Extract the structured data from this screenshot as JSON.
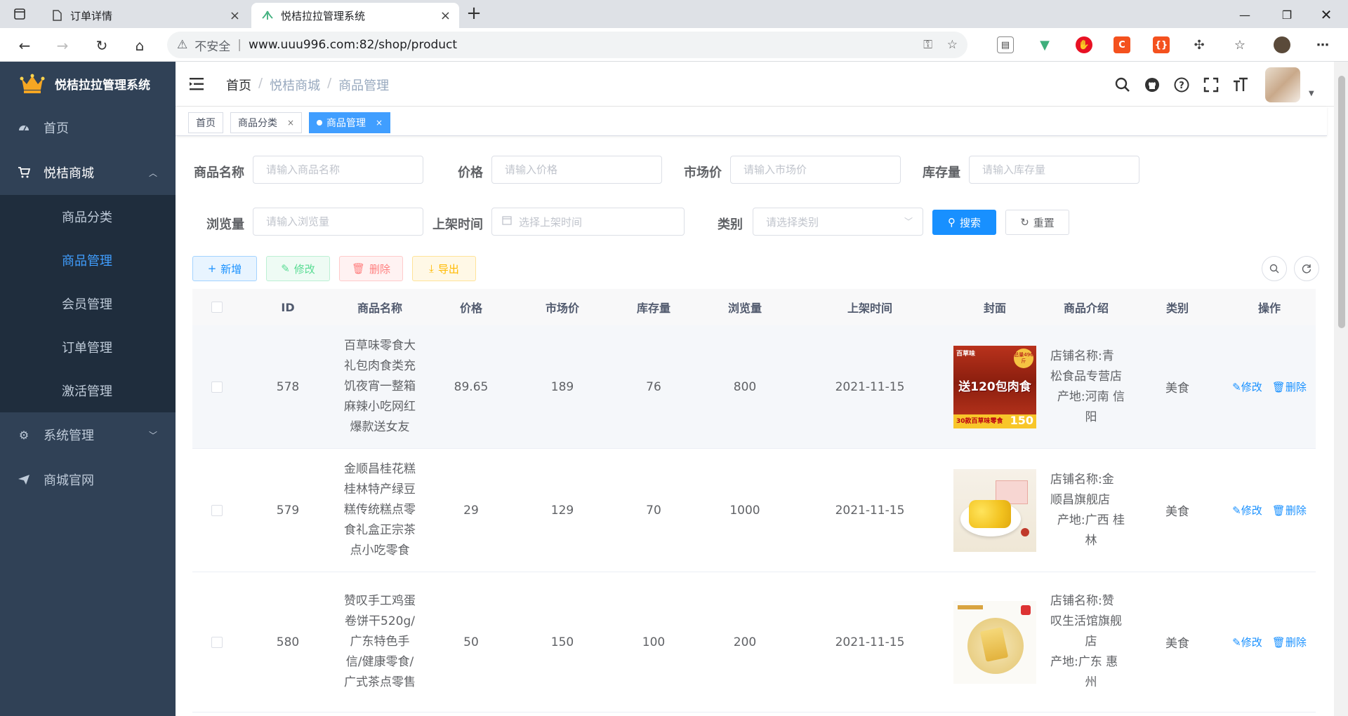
{
  "browser": {
    "tabs": [
      {
        "title": "订单详情",
        "active": false
      },
      {
        "title": "悦桔拉拉管理系统",
        "active": true
      }
    ],
    "address": {
      "security_label": "不安全",
      "url": "www.uuu996.com:82/shop/product"
    }
  },
  "sidebar": {
    "logo_title": "悦桔拉拉管理系统",
    "items": [
      {
        "label": "首页",
        "icon": "dashboard-icon"
      },
      {
        "label": "悦桔商城",
        "icon": "shopping-cart-icon",
        "expanded": true,
        "children": [
          {
            "label": "商品分类",
            "active": false
          },
          {
            "label": "商品管理",
            "active": true
          },
          {
            "label": "会员管理",
            "active": false
          },
          {
            "label": "订单管理",
            "active": false
          },
          {
            "label": "激活管理",
            "active": false
          }
        ]
      },
      {
        "label": "系统管理",
        "icon": "gear-icon"
      },
      {
        "label": "商城官网",
        "icon": "send-icon"
      }
    ]
  },
  "breadcrumb": [
    "首页",
    "悦桔商城",
    "商品管理"
  ],
  "tagsview": [
    {
      "label": "首页",
      "closable": false,
      "active": false
    },
    {
      "label": "商品分类",
      "closable": true,
      "active": false
    },
    {
      "label": "商品管理",
      "closable": true,
      "active": true
    }
  ],
  "search_form": {
    "name_label": "商品名称",
    "name_placeholder": "请输入商品名称",
    "price_label": "价格",
    "price_placeholder": "请输入价格",
    "market_label": "市场价",
    "market_placeholder": "请输入市场价",
    "stock_label": "库存量",
    "stock_placeholder": "请输入库存量",
    "views_label": "浏览量",
    "views_placeholder": "请输入浏览量",
    "time_label": "上架时间",
    "time_placeholder": "选择上架时间",
    "category_label": "类别",
    "category_placeholder": "请选择类别",
    "search_button": "搜索",
    "reset_button": "重置"
  },
  "toolbar": {
    "add": "新增",
    "edit": "修改",
    "delete": "删除",
    "export": "导出"
  },
  "table": {
    "columns": [
      "ID",
      "商品名称",
      "价格",
      "市场价",
      "库存量",
      "浏览量",
      "上架时间",
      "封面",
      "商品介绍",
      "类别",
      "操作"
    ],
    "op_edit": "修改",
    "op_delete": "删除",
    "rows": [
      {
        "id": "578",
        "name": [
          "百草味零食大",
          "礼包肉食类充",
          "饥夜宵一整箱",
          "麻辣小吃网红",
          "爆款送女友"
        ],
        "price": "89.65",
        "market_price": "189",
        "stock": "76",
        "views": "800",
        "date": "2021-11-15",
        "cover": {
          "title": "送120包肉食",
          "brand": "百草味",
          "badge": "总量496斤",
          "strip": "30款百草味零食",
          "price": "150"
        },
        "intro": [
          "店铺名称:青",
          "松食品专营店",
          "产地:河南 信",
          "阳"
        ],
        "category": "美食"
      },
      {
        "id": "579",
        "name": [
          "金顺昌桂花糕",
          "桂林特产绿豆",
          "糕传统糕点零",
          "食礼盒正宗茶",
          "点小吃零食"
        ],
        "price": "29",
        "market_price": "129",
        "stock": "70",
        "views": "1000",
        "date": "2021-11-15",
        "intro": [
          "店铺名称:金",
          "顺昌旗舰店",
          "产地:广西 桂",
          "林"
        ],
        "category": "美食"
      },
      {
        "id": "580",
        "name": [
          "赞叹手工鸡蛋",
          "卷饼干520g/",
          "广东特色手",
          "信/健康零食/",
          "广式茶点零售"
        ],
        "price": "50",
        "market_price": "150",
        "stock": "100",
        "views": "200",
        "date": "2021-11-15",
        "intro": [
          "店铺名称:赞",
          "叹生活馆旗舰",
          "店",
          "产地:广东 惠",
          "州"
        ],
        "category": "美食"
      }
    ]
  },
  "colors": {
    "primary": "#1890ff",
    "sidebar": "#304156",
    "submenu": "#1f2d3d",
    "active_menu": "#409eff"
  }
}
